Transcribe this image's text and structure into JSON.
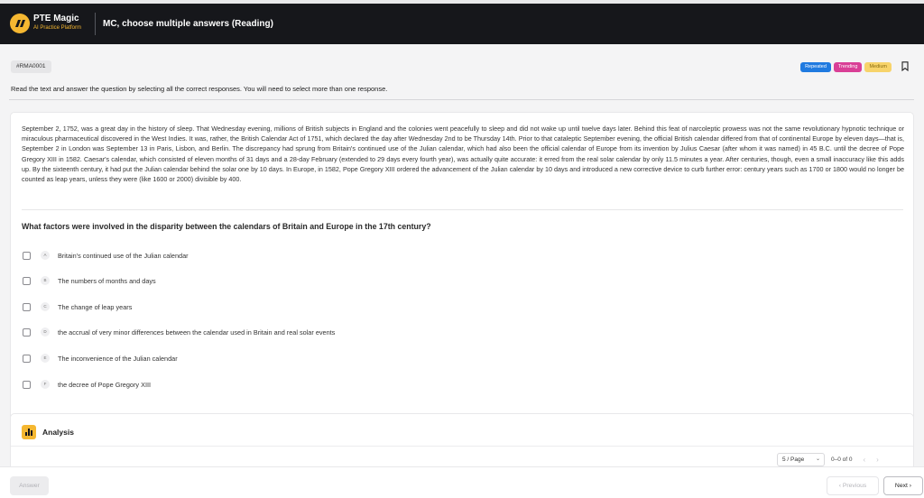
{
  "header": {
    "brand_name": "PTE Magic",
    "brand_sub": "AI Practice Platform",
    "title": "MC, choose multiple answers (Reading)"
  },
  "question_id": "#RMA0001",
  "badges": {
    "repeated": "Repeated",
    "trending": "Trending",
    "medium": "Medium"
  },
  "instruction": "Read the text and answer the question by selecting all the correct responses. You will need to select more than one response.",
  "passage": "September 2, 1752, was a great day in the history of sleep. That Wednesday evening, millions of British subjects in England and the colonies went peacefully to sleep and did not wake up until twelve days later. Behind this feat of narcoleptic prowess was not the same revolutionary hypnotic technique or miraculous pharmaceutical discovered in the West Indies. It was, rather, the British Calendar Act of 1751, which declared the day after Wednesday 2nd to be Thursday 14th. Prior to that cataleptic September evening, the official British calendar differed from that of continental Europe by eleven days—that is, September 2 in London was September 13 in Paris, Lisbon, and Berlin. The discrepancy had sprung from Britain's continued use of the Julian calendar, which had also been the official calendar of Europe from its invention by Julius Caesar (after whom it was named) in 45 B.C. until the decree of Pope Gregory XIII in 1582. Caesar's calendar, which consisted of eleven months of 31 days and a 28-day February (extended to 29 days every fourth year), was actually quite accurate: it erred from the real solar calendar by only 11.5 minutes a year. After centuries, though, even a small inaccuracy like this adds up. By the sixteenth century, it had put the Julian calendar behind the solar one by 10 days. In Europe, in 1582, Pope Gregory XIII ordered the advancement of the Julian calendar by 10 days and introduced a new corrective device to curb further error: century years such as 1700 or 1800 would no longer be counted as leap years, unless they were (like 1600 or 2000) divisible by 400.",
  "question": "What factors were involved in the disparity between the calendars of Britain and Europe in the 17th century?",
  "options": [
    {
      "letter": "A",
      "text": "Britain's continued use of the Julian calendar"
    },
    {
      "letter": "B",
      "text": "The numbers of months and days"
    },
    {
      "letter": "C",
      "text": "The change of leap years"
    },
    {
      "letter": "D",
      "text": "the accrual of very minor differences between the calendar used in Britain and real solar events"
    },
    {
      "letter": "E",
      "text": "The inconvenience of the Julian calendar"
    },
    {
      "letter": "F",
      "text": "the decree of Pope Gregory XIII"
    }
  ],
  "analysis": {
    "title": "Analysis"
  },
  "pagination": {
    "page_size": "5 / Page",
    "range": "0–0 of 0",
    "prev_icon": "‹",
    "next_icon": "›"
  },
  "footer": {
    "answer_label": "Answer",
    "previous_label": "Previous",
    "next_label": "Next"
  },
  "colors": {
    "accent": "#f5b731",
    "header_bg": "#16171b",
    "repeated": "#1f7ae0",
    "trending": "#d93f96",
    "medium": "#f7d36a"
  }
}
